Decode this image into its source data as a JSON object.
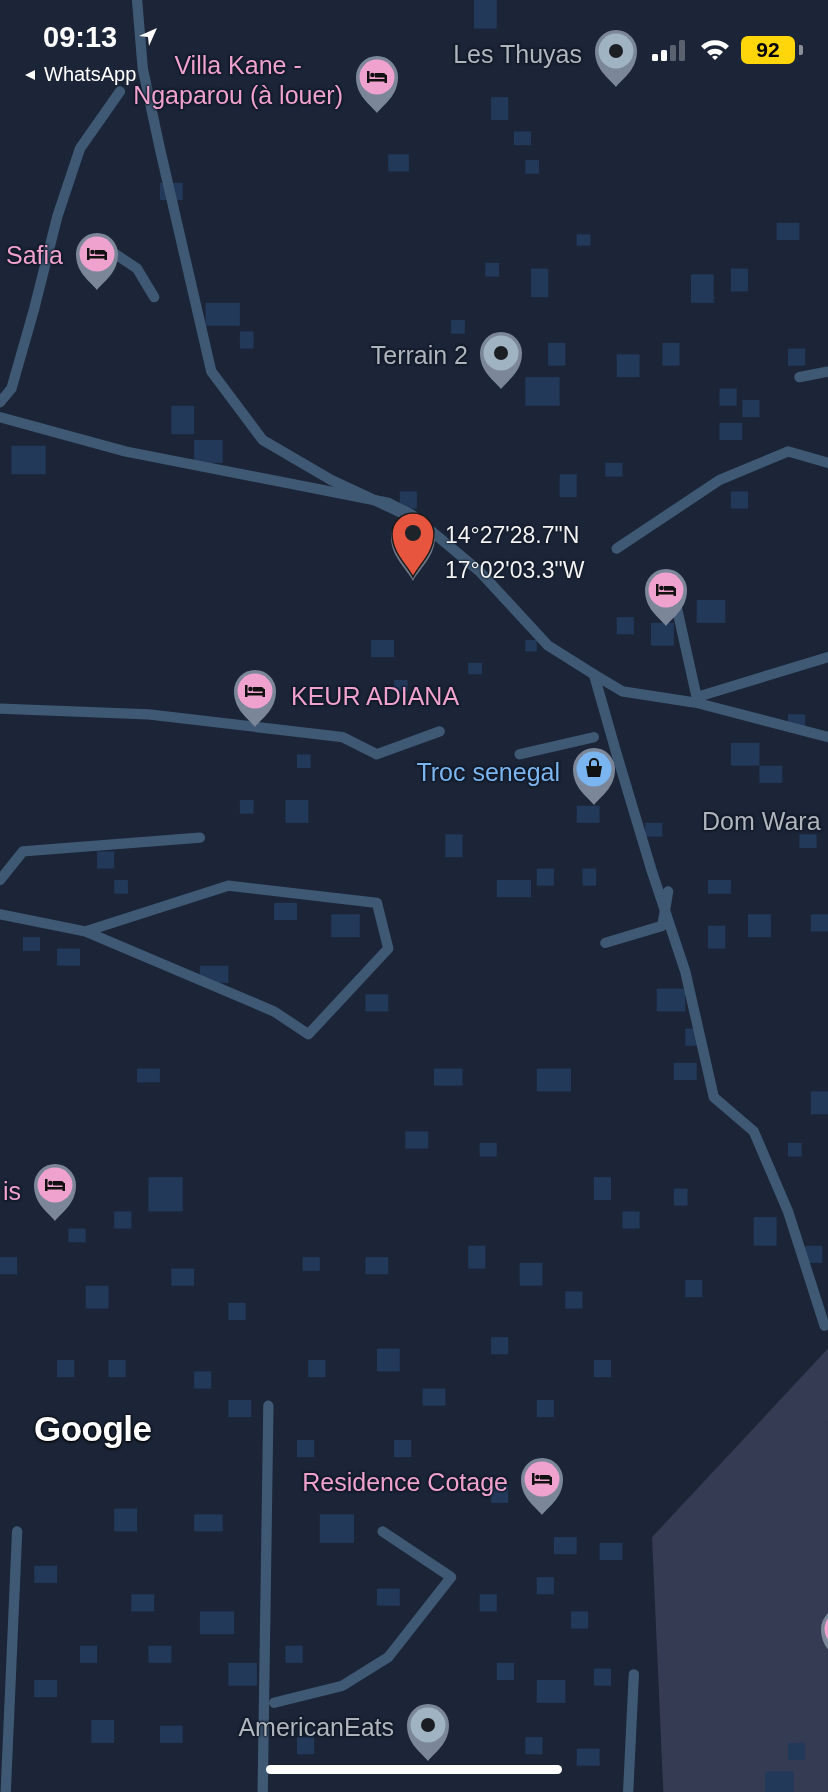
{
  "status_bar": {
    "time": "09:13",
    "back_app": "WhatsApp",
    "battery": "92"
  },
  "map": {
    "places": [
      {
        "kind": "lodging",
        "label": [
          "Villa Kane -",
          "Ngaparou (à louer)"
        ]
      },
      {
        "kind": "landmark",
        "label": "Les Thuyas"
      },
      {
        "kind": "lodging",
        "label": "Safia"
      },
      {
        "kind": "landmark",
        "label": "Terrain 2"
      },
      {
        "kind": "lodging"
      },
      {
        "kind": "lodging",
        "label": "KEUR ADIANA"
      },
      {
        "kind": "shopping",
        "label": "Troc senegal"
      },
      {
        "kind": "area",
        "label": "Dom Wara"
      },
      {
        "kind": "lodging",
        "label": "is"
      },
      {
        "kind": "lodging",
        "label": "Residence Cotage"
      },
      {
        "kind": "lodging"
      },
      {
        "kind": "landmark",
        "label": "AmericanEats"
      }
    ],
    "dropped_pin": {
      "latitude": "14°27'28.7\"N",
      "longitude": "17°02'03.3\"W"
    },
    "attribution": "Google"
  }
}
